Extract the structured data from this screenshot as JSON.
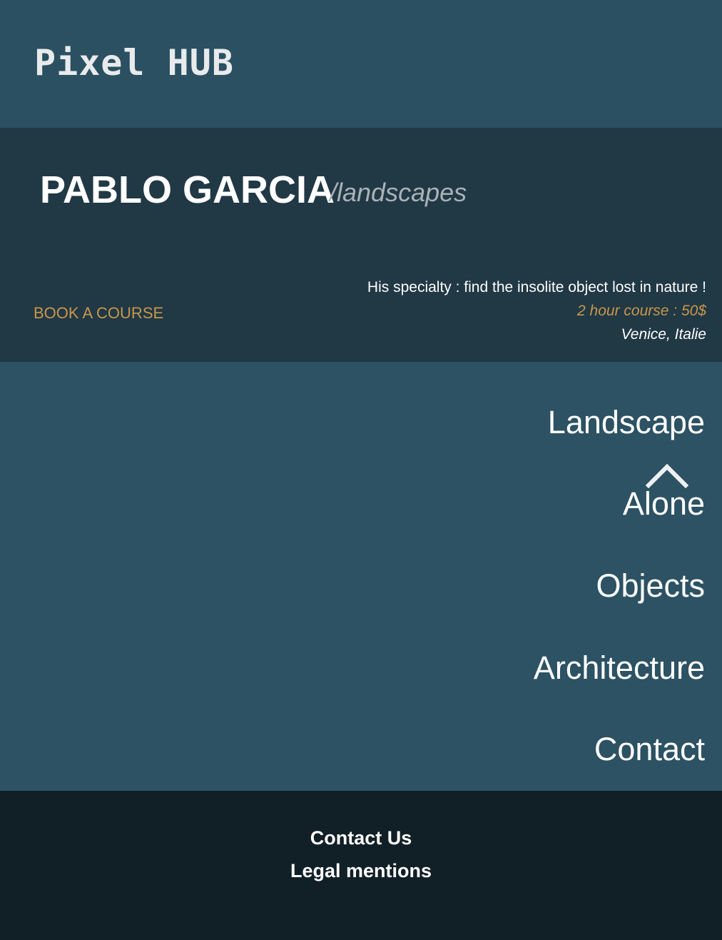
{
  "header": {
    "logo_text": "Pixel HUB"
  },
  "profile": {
    "name": "PABLO GARCIA",
    "category": "/landscapes",
    "book_label": "BOOK A COURSE",
    "specialty": "His specialty : find the insolite object lost in nature !",
    "price": "2 hour course : 50$",
    "location": "Venice, Italie"
  },
  "nav": {
    "items": [
      {
        "label": "Landscape"
      },
      {
        "label": "Alone"
      },
      {
        "label": "Objects"
      },
      {
        "label": "Architecture"
      },
      {
        "label": "Contact"
      }
    ],
    "scroll_up_icon": "chevron-up-icon"
  },
  "footer": {
    "contact_label": "Contact Us",
    "legal_label": "Legal mentions"
  },
  "colors": {
    "header_bg": "#2a5061",
    "profile_bg": "#213845",
    "nav_bg": "#2c5263",
    "footer_bg": "#111f26",
    "accent": "#c8974b",
    "muted": "#a9b2b7"
  }
}
